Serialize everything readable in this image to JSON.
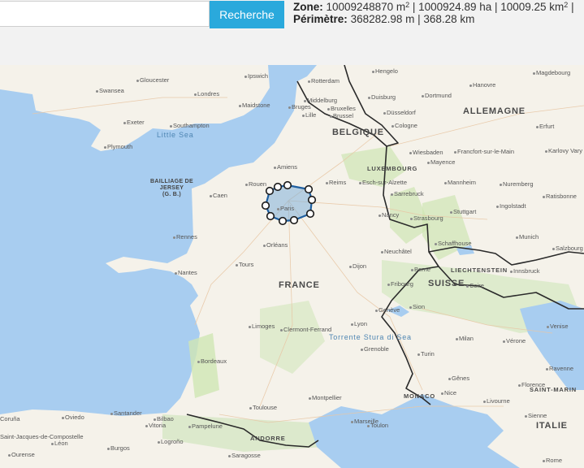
{
  "search": {
    "placeholder": "",
    "value": "",
    "button_label": "Recherche"
  },
  "stats": {
    "zone_label": "Zone:",
    "zone_m2_value": "10009248870 m",
    "zone_m2_sup": "2",
    "zone_ha": " | 1000924.89 ha | 10009.25 km",
    "zone_km2_sup": "2",
    "zone_tail": " |",
    "perimeter_label": "Périmètre:",
    "perimeter_value": "368282.98 m | 368.28 km"
  },
  "map": {
    "colors": {
      "sea": "#a8cdf0",
      "land": "#f5f2ea",
      "forest": "#cfe6b4",
      "polygon_fill": "#7fb0d8",
      "polygon_stroke": "#1f5fa0",
      "border": "#2a2a2a",
      "roads": "#e8c7a5"
    },
    "countries": [
      {
        "key": "france",
        "text": "FRANCE"
      },
      {
        "key": "allemagne",
        "text": "ALLEMAGNE"
      },
      {
        "key": "belgique",
        "text": "BELGIQUE"
      },
      {
        "key": "suisse",
        "text": "SUISSE"
      },
      {
        "key": "italie",
        "text": "ITALIE"
      },
      {
        "key": "luxembourg",
        "text": "LUXEMBOURG"
      },
      {
        "key": "liechtenstein",
        "text": "LIECHTENSTEIN"
      },
      {
        "key": "monaco",
        "text": "MONACO"
      },
      {
        "key": "andorre",
        "text": "ANDORRE"
      },
      {
        "key": "saint-marin",
        "text": "SAINT-MARIN"
      }
    ],
    "seas": [
      {
        "key": "little-sea",
        "text": "Little Sea"
      },
      {
        "key": "torrente",
        "text": "Torrente Stura di Sea"
      }
    ],
    "regions": [
      {
        "key": "bailliage",
        "text": "BAILLIAGE DE\nJERSEY\n(G. B.)"
      }
    ],
    "cities": [
      "Ipswich",
      "Rotterdam",
      "Hengelo",
      "Hanovre",
      "Magdebourg",
      "Gloucester",
      "Swansea",
      "Londres",
      "Maidstone",
      "Middelburg",
      "Duisburg",
      "Dortmund",
      "Exeter",
      "Southampton",
      "Bruges",
      "Bruxelles",
      "Brussel",
      "Düsseldorf",
      "Cologne",
      "Plymouth",
      "Lille",
      "Erfurt",
      "Amiens",
      "Wiesbaden",
      "Francfort-sur-le-Main",
      "Karlovy Vary",
      "Mayence",
      "Caen",
      "Rouen",
      "Paris",
      "Reims",
      "Esch-sur-Alzette",
      "Sarrebruck",
      "Mannheim",
      "Nuremberg",
      "Ratisbonne",
      "Nancy",
      "Strasbourg",
      "Stuttgart",
      "Ingolstadt",
      "Rennes",
      "Orléans",
      "Munich",
      "Salzbourg",
      "Schaffhouse",
      "Tours",
      "Dijon",
      "Innsbruck",
      "Nantes",
      "Neuchâtel",
      "Berne",
      "Fribourg",
      "Coire",
      "Genève",
      "Sion",
      "Limoges",
      "Clermont-Ferrand",
      "Lyon",
      "Milan",
      "Vérone",
      "Venise",
      "Grenoble",
      "Turin",
      "Bordeaux",
      "Ravenne",
      "Gênes",
      "Montpellier",
      "Nice",
      "Toulouse",
      "Livourne",
      "Florence",
      "Oviedo",
      "Santander",
      "Bilbao",
      "Vitoria",
      "Pampelune",
      "Marseille",
      "Toulon",
      "Saint-Jacques-de-Compostelle",
      "Coruña",
      "Burgos",
      "Léon",
      "Ourense",
      "Sienne",
      "Rome",
      "Logroño",
      "Saragosse"
    ],
    "polygon_vertices": 10
  }
}
